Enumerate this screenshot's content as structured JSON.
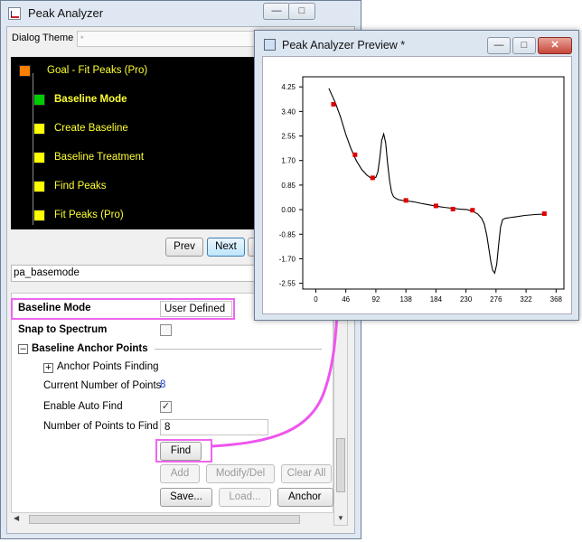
{
  "main_window": {
    "title": "Peak Analyzer",
    "dialog_theme_label": "Dialog Theme",
    "dialog_theme_value": "*",
    "tree": [
      {
        "label": "Goal - Fit Peaks (Pro)",
        "color": "#ff7f00"
      },
      {
        "label": "Baseline Mode",
        "color": "#00cc00",
        "active": true
      },
      {
        "label": "Create Baseline",
        "color": "#ffff00"
      },
      {
        "label": "Baseline Treatment",
        "color": "#ffff00"
      },
      {
        "label": "Find Peaks",
        "color": "#ffff00"
      },
      {
        "label": "Fit Peaks (Pro)",
        "color": "#ffff00"
      }
    ],
    "prev_label": "Prev",
    "next_label": "Next",
    "page_name": "pa_basemode",
    "props": {
      "baseline_mode_label": "Baseline Mode",
      "baseline_mode_value": "User Defined",
      "snap_label": "Snap to Spectrum",
      "snap_checked": false,
      "anchor_section": "Baseline Anchor Points",
      "anchor_finding": "Anchor Points Finding",
      "current_points_label": "Current Number of Points",
      "current_points_value": "8",
      "auto_find_label": "Enable Auto Find",
      "auto_find_checked": true,
      "points_to_find_label": "Number of Points to Find",
      "points_to_find_value": "8",
      "find_label": "Find",
      "add_label": "Add",
      "modify_label": "Modify/Del",
      "clear_label": "Clear All",
      "save_label": "Save...",
      "load_label": "Load...",
      "anchor_points_label": "Anchor Po"
    }
  },
  "preview_window": {
    "title": "Peak Analyzer Preview *"
  },
  "chart_data": {
    "type": "line",
    "x_ticks": [
      "0",
      "46",
      "92",
      "138",
      "184",
      "230",
      "276",
      "322",
      "368"
    ],
    "y_ticks": [
      "4.25",
      "3.40",
      "2.55",
      "1.70",
      "0.85",
      "0.00",
      "-0.85",
      "-1.70",
      "-2.55"
    ],
    "xlim": [
      -20,
      380
    ],
    "ylim": [
      -2.75,
      4.6
    ],
    "curve": {
      "x": [
        20,
        25,
        30,
        38,
        46,
        54,
        62,
        70,
        78,
        84,
        88,
        92,
        95,
        98,
        101,
        104,
        107,
        110,
        113,
        116,
        119,
        122,
        126,
        132,
        140,
        150,
        160,
        172,
        184,
        196,
        208,
        220,
        232,
        240,
        248,
        254,
        258,
        262,
        265,
        268,
        271,
        274,
        277,
        280,
        283,
        286,
        290,
        296,
        306,
        320,
        336,
        350
      ],
      "y": [
        4.2,
        3.95,
        3.7,
        3.2,
        2.6,
        2.1,
        1.7,
        1.4,
        1.2,
        1.1,
        1.08,
        1.12,
        1.3,
        1.8,
        2.4,
        2.62,
        2.3,
        1.6,
        1.0,
        0.6,
        0.45,
        0.4,
        0.35,
        0.32,
        0.3,
        0.27,
        0.22,
        0.17,
        0.12,
        0.08,
        0.05,
        0.02,
        0.0,
        -0.05,
        -0.15,
        -0.3,
        -0.5,
        -0.9,
        -1.35,
        -1.8,
        -2.1,
        -2.2,
        -1.9,
        -1.2,
        -0.6,
        -0.35,
        -0.3,
        -0.28,
        -0.25,
        -0.2,
        -0.17,
        -0.15
      ]
    },
    "anchor_points": {
      "x": [
        27,
        60,
        87,
        138,
        184,
        210,
        240,
        350
      ],
      "y": [
        3.65,
        1.9,
        1.1,
        0.32,
        0.13,
        0.02,
        -0.02,
        -0.14
      ]
    },
    "colors": {
      "line": "#000000",
      "markers": "#e00000"
    }
  }
}
